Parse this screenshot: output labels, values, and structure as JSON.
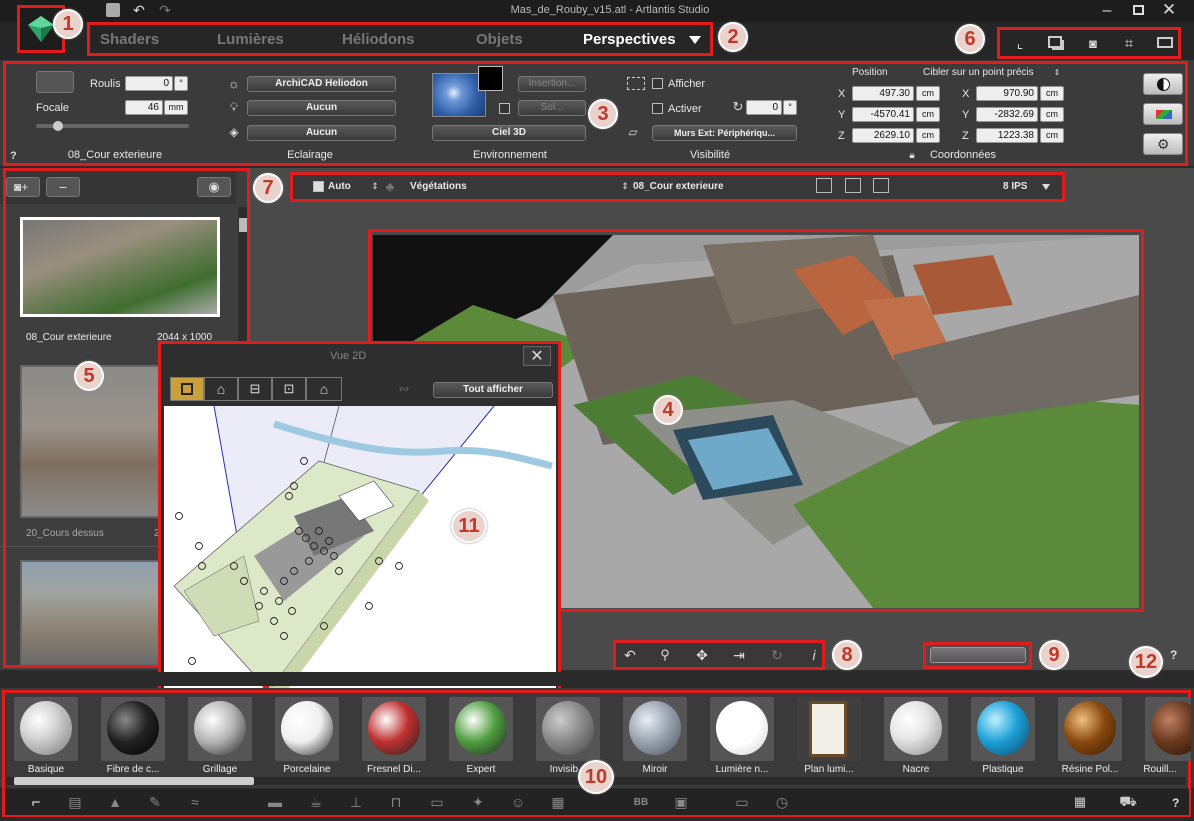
{
  "window": {
    "title": "Mas_de_Rouby_v15.atl - Artlantis Studio"
  },
  "tabs": [
    {
      "label": "Shaders"
    },
    {
      "label": "Lumières"
    },
    {
      "label": "Héliodons"
    },
    {
      "label": "Objets"
    },
    {
      "label": "Perspectives",
      "active": true
    }
  ],
  "callouts": [
    "1",
    "2",
    "3",
    "4",
    "5",
    "6",
    "7",
    "8",
    "9",
    "10",
    "11",
    "12"
  ],
  "inspector": {
    "roulis_label": "Roulis",
    "roulis_value": "0",
    "deg_unit": "°",
    "focale_label": "Focale",
    "focale_value": "46",
    "focale_unit": "mm",
    "help": "?",
    "view_name": "08_Cour exterieure",
    "heliodon_select": "ArchiCAD Heliodon",
    "light_select": "Aucun",
    "light_select2": "Aucun",
    "eclairage_label": "Eclairage",
    "insertion_btn": "Insertion...",
    "sol_btn": "Sol...",
    "env_select": "Ciel 3D",
    "environnement_label": "Environnement",
    "afficher_label": "Afficher",
    "activer_label": "Activer",
    "angle_value": "0",
    "walls_select": "Murs Ext: Périphériqu...",
    "visibilite_label": "Visibilité",
    "position_label": "Position",
    "target_label": "Cibler sur un point précis",
    "x_label": "X",
    "y_label": "Y",
    "z_label": "Z",
    "pos_x": "497.30",
    "pos_y": "-4570.41",
    "pos_z": "2629.10",
    "tgt_x": "970.90",
    "tgt_y": "-2832.69",
    "tgt_z": "1223.38",
    "cm": "cm",
    "coordonnees_label": "Coordonnées"
  },
  "viewbar": {
    "auto_label": "Auto",
    "vegetation_label": "Végétations",
    "view_select": "08_Cour exterieure",
    "fps": "8 IPS"
  },
  "sidebar": {
    "items": [
      {
        "name": "08_Cour exterieure",
        "size": "2044 x 1000"
      },
      {
        "name": "20_Cours dessus",
        "size": "2"
      }
    ]
  },
  "vue2d": {
    "title": "Vue 2D",
    "select": "Tout afficher",
    "help": "?"
  },
  "bottom_help": "?",
  "catalog": {
    "materials": [
      {
        "label": "Basique",
        "color": "#d8d8d8"
      },
      {
        "label": "Fibre de c...",
        "color": "#222222"
      },
      {
        "label": "Grillage",
        "color": "#b5b5b5"
      },
      {
        "label": "Porcelaine",
        "color": "#f0f0f0"
      },
      {
        "label": "Fresnel Di...",
        "color": "#c03030"
      },
      {
        "label": "Expert",
        "color": "#50a040"
      },
      {
        "label": "Invisib...",
        "color": "#8a8a8a"
      },
      {
        "label": "Miroir",
        "color": "#9aa4b0"
      },
      {
        "label": "Lumière n...",
        "color": "#ffffff"
      },
      {
        "label": "Plan lumi...",
        "color": "#e8e0d0"
      },
      {
        "label": "Nacre",
        "color": "#e6e6e6"
      },
      {
        "label": "Plastique",
        "color": "#1ea0d8"
      },
      {
        "label": "Résine Pol...",
        "color": "#8a4a10"
      },
      {
        "label": "Rouill...",
        "color": "#6a3a20"
      }
    ],
    "help": "?"
  },
  "colors": {
    "accent": "#e21c1c",
    "panel": "#3a3a3a",
    "dark": "#1f1f1f"
  }
}
